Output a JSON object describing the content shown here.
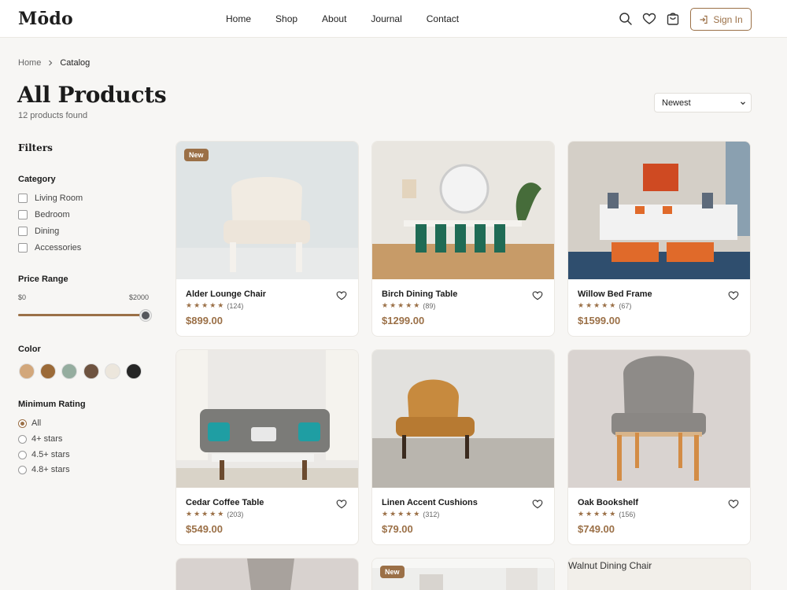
{
  "app": {
    "logo": "Mōdo",
    "nav": [
      "Home",
      "Shop",
      "About",
      "Journal",
      "Contact"
    ],
    "sign_in": "Sign In",
    "icons": [
      "search-icon",
      "heart-icon",
      "cart-icon",
      "sign-in-icon"
    ]
  },
  "breadcrumb": {
    "home": "Home",
    "current": "Catalog"
  },
  "page": {
    "title": "All Products",
    "count": "12 products found"
  },
  "sort": {
    "selected": "Newest"
  },
  "filters": {
    "title": "Filters",
    "category": {
      "title": "Category",
      "items": [
        "Living Room",
        "Bedroom",
        "Dining",
        "Accessories"
      ]
    },
    "price": {
      "title": "Price Range",
      "min": "$0",
      "max": "$2000",
      "level_fraction": 1.0
    },
    "color": {
      "title": "Color",
      "swatches": [
        "#d2a77b",
        "#9b6a38",
        "#95ad9f",
        "#6e5340",
        "#ece6dc",
        "#262626"
      ]
    },
    "rating": {
      "title": "Minimum Rating",
      "options": [
        "All",
        "4+ stars",
        "4.5+ stars",
        "4.8+ stars"
      ],
      "selected": "All"
    }
  },
  "products": [
    {
      "name": "Alder Lounge Chair",
      "stars": "★★★★★",
      "reviews": "(124)",
      "price": "$899.00",
      "badge": "New"
    },
    {
      "name": "Birch Dining Table",
      "stars": "★★★★★",
      "reviews": "(89)",
      "price": "$1299.00",
      "badge": ""
    },
    {
      "name": "Willow Bed Frame",
      "stars": "★★★★★",
      "reviews": "(67)",
      "price": "$1599.00",
      "badge": ""
    },
    {
      "name": "Cedar Coffee Table",
      "stars": "★★★★★",
      "reviews": "(203)",
      "price": "$549.00",
      "badge": ""
    },
    {
      "name": "Linen Accent Cushions",
      "stars": "★★★★★",
      "reviews": "(312)",
      "price": "$79.00",
      "badge": ""
    },
    {
      "name": "Oak Bookshelf",
      "stars": "★★★★★",
      "reviews": "(156)",
      "price": "$749.00",
      "badge": ""
    }
  ],
  "partial_row": {
    "badge": "New",
    "alt_text": "Walnut Dining Chair"
  },
  "colors": {
    "accent": "#9b7047",
    "background": "#f7f6f4"
  }
}
